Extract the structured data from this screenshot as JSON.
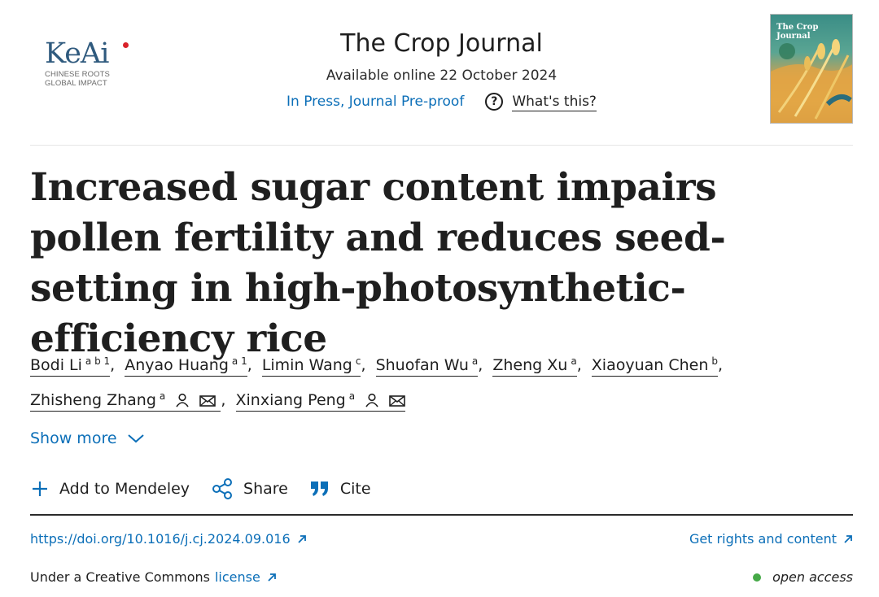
{
  "logo": {
    "name": "KeAi",
    "tagline_line1": "CHINESE ROOTS",
    "tagline_line2": "GLOBAL IMPACT"
  },
  "journal": {
    "name": "The Crop Journal",
    "available_online": "Available online 22 October 2024",
    "status_link": "In Press, Journal Pre-proof",
    "whats_this": "What's this?",
    "cover_title": "The Crop Journal"
  },
  "article": {
    "title": "Increased sugar content impairs pollen fertility and reduces seed-setting in high-photosynthetic-efficiency rice"
  },
  "authors": [
    {
      "name": "Bodi Li",
      "affil": "a b 1"
    },
    {
      "name": "Anyao Huang",
      "affil": "a 1"
    },
    {
      "name": "Limin Wang",
      "affil": "c"
    },
    {
      "name": "Shuofan Wu",
      "affil": "a"
    },
    {
      "name": "Zheng Xu",
      "affil": "a"
    },
    {
      "name": "Xiaoyuan Chen",
      "affil": "b"
    },
    {
      "name": "Zhisheng Zhang",
      "affil": "a"
    },
    {
      "name": "Xinxiang Peng",
      "affil": "a"
    }
  ],
  "show_more": "Show more",
  "actions": {
    "mendeley": "Add to Mendeley",
    "share": "Share",
    "cite": "Cite"
  },
  "links": {
    "doi": "https://doi.org/10.1016/j.cj.2024.09.016",
    "rights": "Get rights and content",
    "license_prefix": "Under a Creative Commons",
    "license_link": "license",
    "open_access": "open access"
  },
  "colors": {
    "link": "#0c6fb8",
    "open_access_dot": "#45a947",
    "logo": "#2f5a7e"
  }
}
